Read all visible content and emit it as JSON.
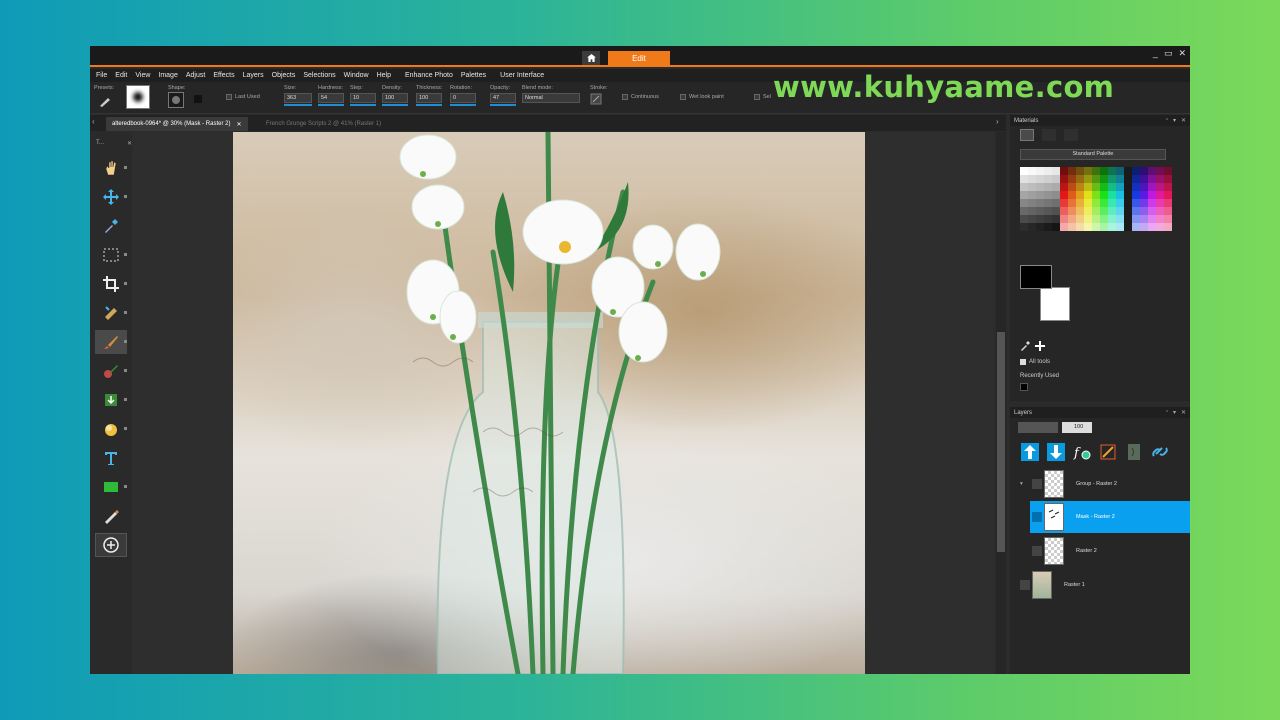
{
  "watermark": "www.kuhyaame.com",
  "titlebar": {
    "tab_edit": "Edit",
    "home_icon": "home-icon",
    "window_controls": [
      "_",
      "▭",
      "✕"
    ]
  },
  "menu": [
    "File",
    "Edit",
    "View",
    "Image",
    "Adjust",
    "Effects",
    "Layers",
    "Objects",
    "Selections",
    "Window",
    "Help",
    "Enhance Photo",
    "Palettes",
    "User Interface"
  ],
  "options": {
    "presets_label": "Presets:",
    "shape_label": "Shape:",
    "last_used_label": "Last Used",
    "size_label": "Size:",
    "size_value": "363",
    "hardness_label": "Hardness:",
    "hardness_value": "54",
    "step_label": "Step:",
    "step_value": "10",
    "density_label": "Density:",
    "density_value": "100",
    "thickness_label": "Thickness:",
    "thickness_value": "100",
    "rotation_label": "Rotation:",
    "rotation_value": "0",
    "opacity_label": "Opacity:",
    "opacity_value": "47",
    "blend_label": "Blend mode:",
    "blend_value": "Normal",
    "stroke_label": "Stroke:",
    "continuous_label": "Continuous",
    "wet_label": "Wet look paint",
    "select_label": "Sel"
  },
  "tabs": {
    "active": "alteredbook-0964* @  30% (Mask - Raster 2)",
    "inactive": "French Grunge Scripts 2 @  41% (Raster 1)"
  },
  "toolbox": {
    "title": "T...",
    "tools": [
      "pan-icon",
      "move-icon",
      "dropper-icon",
      "selection-icon",
      "crop-icon",
      "straighten-icon",
      "paintbrush-icon",
      "clone-icon",
      "fill-icon",
      "dodge-icon",
      "text-icon",
      "shape-icon",
      "pen-icon",
      "add-icon"
    ]
  },
  "materials": {
    "title": "Materials",
    "palette": "Standard Palette",
    "all_tools": "All tools",
    "recently_used": "Recently Used"
  },
  "layers": {
    "title": "Layers",
    "opacity": "100",
    "rows": [
      {
        "name": "Group - Raster 2"
      },
      {
        "name": "Mask - Raster 2"
      },
      {
        "name": "Raster 2"
      },
      {
        "name": "Raster 1"
      }
    ]
  },
  "colors": {
    "accent": "#f07a1a",
    "selection": "#0aa0f0",
    "watermark": "#7ed957"
  }
}
